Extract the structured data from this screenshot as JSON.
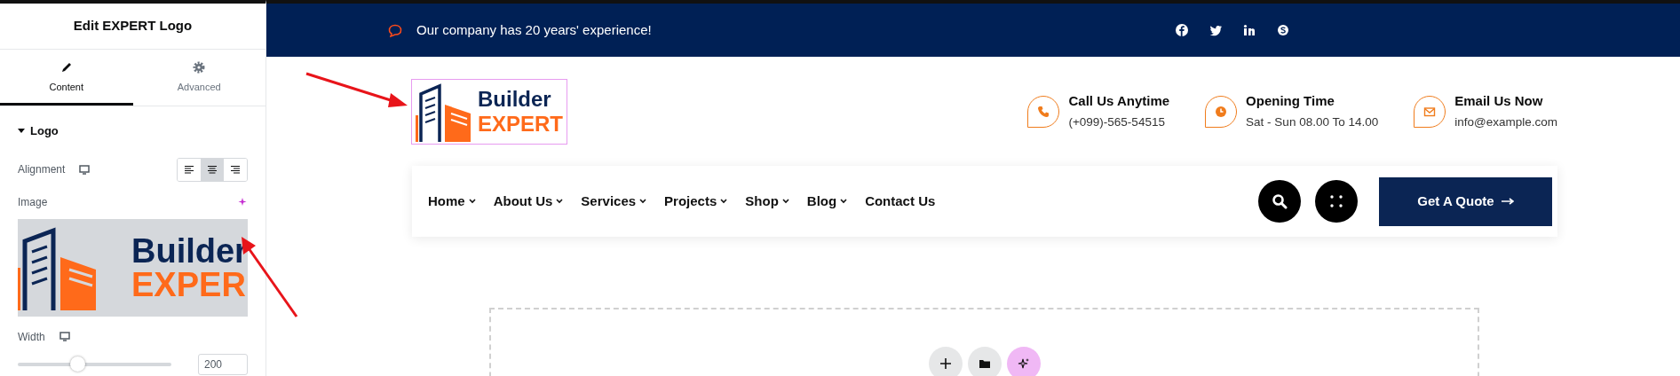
{
  "panel": {
    "title": "Edit EXPERT Logo",
    "tabs": [
      {
        "label": "Content",
        "kind": "pencil",
        "selected": true
      },
      {
        "label": "Advanced",
        "kind": "gear",
        "selected": false
      }
    ],
    "section": {
      "title": "Logo",
      "expanded": true
    },
    "alignment": {
      "label": "Alignment",
      "options": [
        {
          "kind": "left",
          "selected": false
        },
        {
          "kind": "center",
          "selected": true
        },
        {
          "kind": "right",
          "selected": false
        }
      ]
    },
    "image": {
      "label": "Image",
      "logo_line1": "Builder",
      "logo_line2": "EXPER"
    },
    "width": {
      "label": "Width",
      "level": 0.39,
      "value": "200"
    }
  },
  "site": {
    "topbar": {
      "message": "Our company has 20 years' experience!"
    },
    "logo": {
      "line1": "Builder",
      "line2": "EXPERT",
      "selected": true
    },
    "contacts": [
      {
        "kind": "phone",
        "title": "Call Us Anytime",
        "detail": "(+099)-565-54515"
      },
      {
        "kind": "clock",
        "title": "Opening Time",
        "detail": "Sat - Sun 08.00 To 14.00"
      },
      {
        "kind": "mail",
        "title": "Email Us Now",
        "detail": "info@example.com"
      }
    ],
    "nav": [
      {
        "label": "Home",
        "dropdown": true
      },
      {
        "label": "About Us",
        "dropdown": true
      },
      {
        "label": "Services",
        "dropdown": true
      },
      {
        "label": "Projects",
        "dropdown": true
      },
      {
        "label": "Shop",
        "dropdown": true
      },
      {
        "label": "Blog",
        "dropdown": true
      },
      {
        "label": "Contact Us",
        "dropdown": false
      }
    ],
    "quote_button": "Get A Quote"
  }
}
